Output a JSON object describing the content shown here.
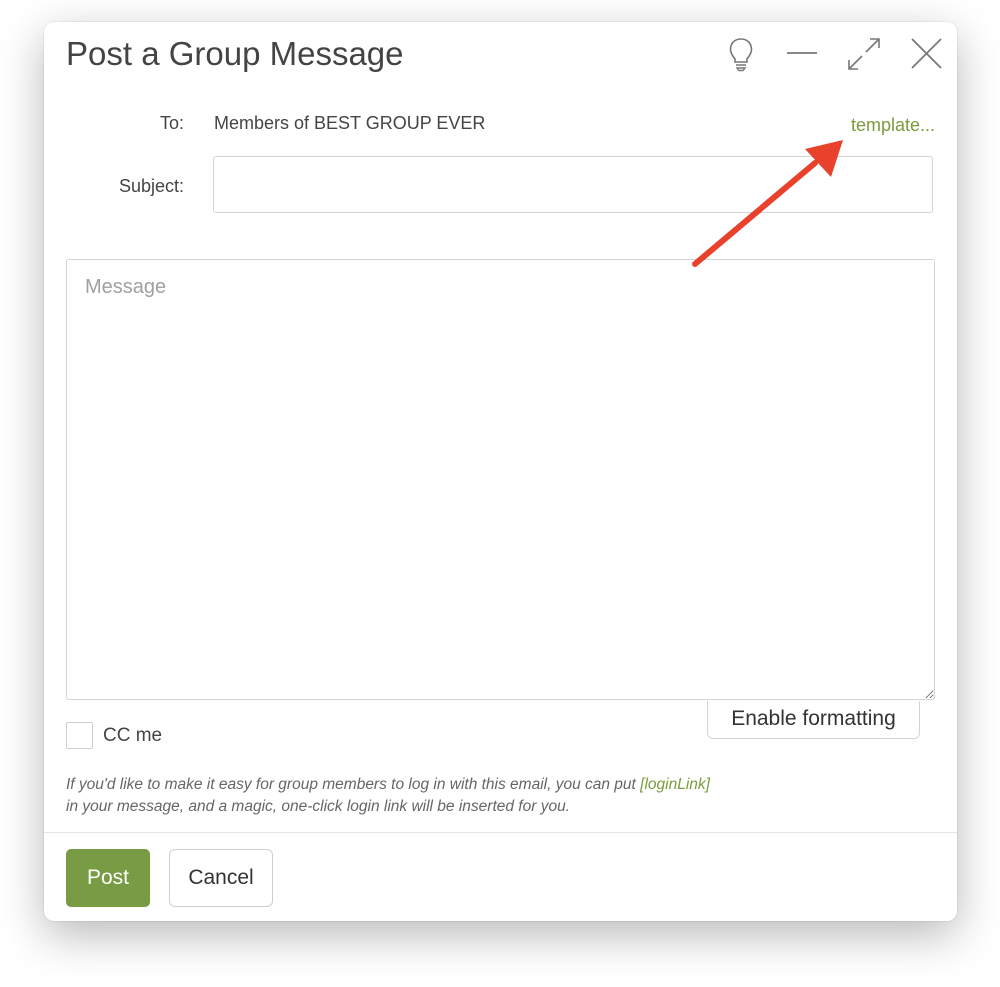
{
  "dialog": {
    "title": "Post a Group Message"
  },
  "window_controls": {
    "icons": [
      "lightbulb-icon",
      "minimize-icon",
      "expand-icon",
      "close-icon"
    ]
  },
  "form": {
    "to_label": "To:",
    "to_value": "Members of BEST GROUP EVER",
    "template_link": "template...",
    "subject_label": "Subject:",
    "subject_value": "",
    "message_placeholder": "Message",
    "cc_label": "CC me",
    "cc_checked": false,
    "enable_formatting_label": "Enable formatting"
  },
  "hint": {
    "line1_prefix": "If you'd like to make it easy for group members to log in with this email, you can put ",
    "code": "[loginLink]",
    "line2": "in your message, and a magic, one-click login link will be inserted for you."
  },
  "footer": {
    "post_label": "Post",
    "cancel_label": "Cancel"
  },
  "colors": {
    "accent_green": "#779c44",
    "link_green": "#7a9c3c",
    "annotation_arrow": "#e8412c"
  }
}
